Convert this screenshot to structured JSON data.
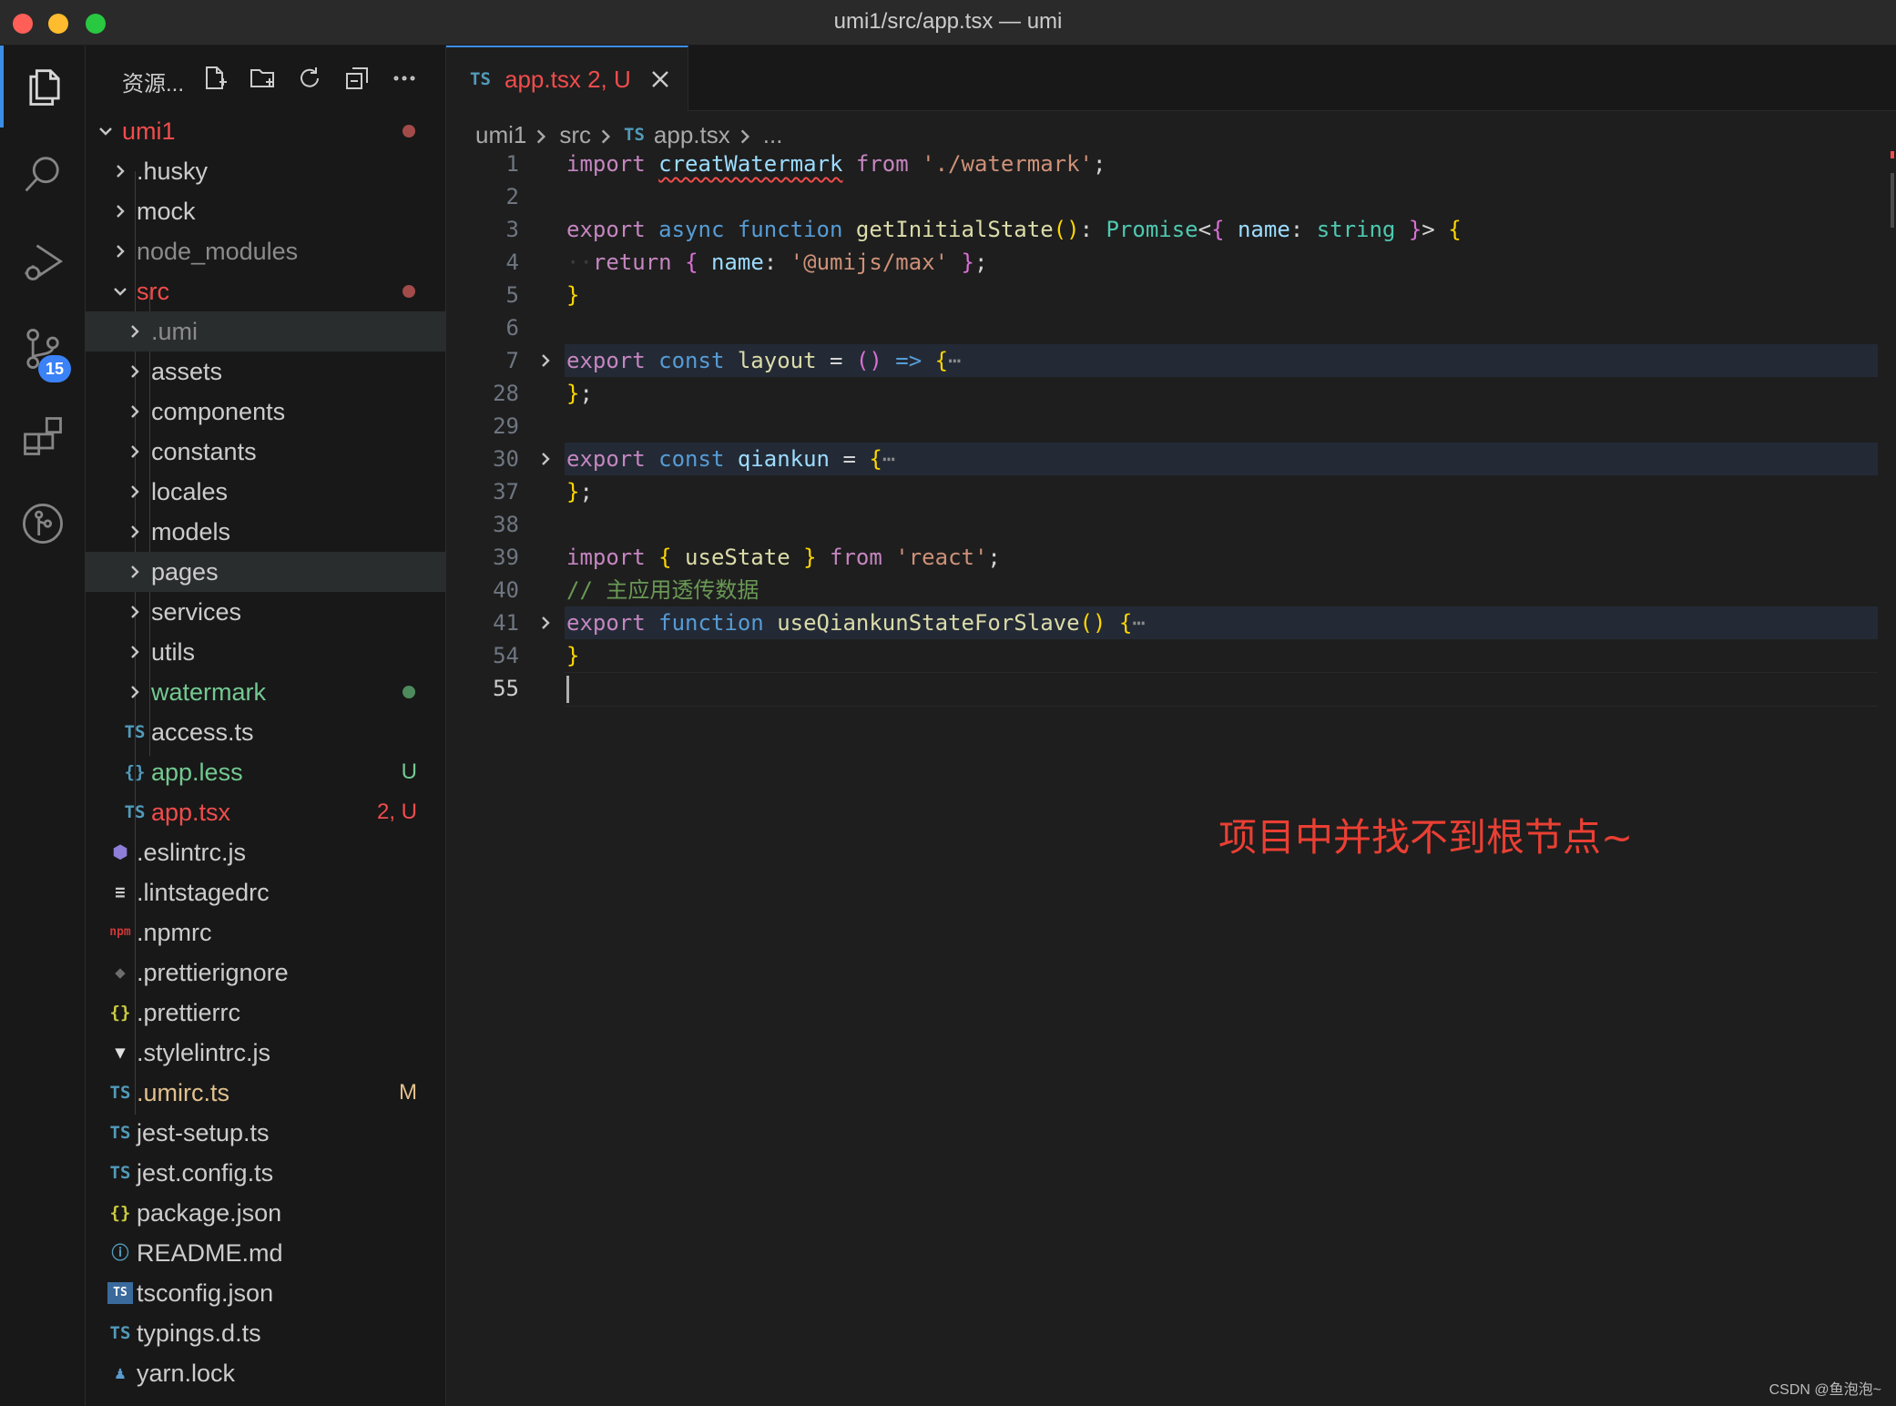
{
  "window": {
    "title": "umi1/src/app.tsx — umi"
  },
  "activity_bar": {
    "items": [
      "explorer-icon",
      "search-icon",
      "run-debug-icon",
      "source-control-icon",
      "extensions-icon",
      "git-graph-icon"
    ],
    "source_control_badge": "15"
  },
  "explorer": {
    "title": "资源...",
    "toolbar": [
      "new-file-icon",
      "new-folder-icon",
      "refresh-icon",
      "collapse-all-icon",
      "more-icon"
    ],
    "rows": [
      {
        "label": "umi1",
        "kind": "folder-open",
        "depth": 0,
        "color": "#f14c4c",
        "dot": "#a34a4a"
      },
      {
        "label": ".husky",
        "kind": "folder",
        "depth": 1
      },
      {
        "label": "mock",
        "kind": "folder",
        "depth": 1
      },
      {
        "label": "node_modules",
        "kind": "folder",
        "depth": 1,
        "color": "#8b8b8b"
      },
      {
        "label": "src",
        "kind": "folder-open",
        "depth": 1,
        "color": "#f14c4c",
        "dot": "#a34a4a"
      },
      {
        "label": ".umi",
        "kind": "folder",
        "depth": 2,
        "color": "#8b8b8b",
        "selected": true
      },
      {
        "label": "assets",
        "kind": "folder",
        "depth": 2
      },
      {
        "label": "components",
        "kind": "folder",
        "depth": 2
      },
      {
        "label": "constants",
        "kind": "folder",
        "depth": 2
      },
      {
        "label": "locales",
        "kind": "folder",
        "depth": 2
      },
      {
        "label": "models",
        "kind": "folder",
        "depth": 2
      },
      {
        "label": "pages",
        "kind": "folder",
        "depth": 2,
        "selected": true
      },
      {
        "label": "services",
        "kind": "folder",
        "depth": 2
      },
      {
        "label": "utils",
        "kind": "folder",
        "depth": 2
      },
      {
        "label": "watermark",
        "kind": "folder",
        "depth": 2,
        "color": "#73c991",
        "dot": "#4d8a5c"
      },
      {
        "label": "access.ts",
        "kind": "file",
        "icon": "TS",
        "icon_color": "#519aba",
        "depth": 2
      },
      {
        "label": "app.less",
        "kind": "file",
        "icon": "{}",
        "icon_color": "#519aba",
        "depth": 2,
        "color": "#73c991",
        "deco": "U",
        "deco_color": "#73c991"
      },
      {
        "label": "app.tsx",
        "kind": "file",
        "icon": "TS",
        "icon_color": "#519aba",
        "depth": 2,
        "color": "#f14c4c",
        "deco": "2, U",
        "deco_color": "#f14c4c"
      },
      {
        "label": ".eslintrc.js",
        "kind": "file",
        "icon": "⬢",
        "icon_color": "#8f7ed8",
        "depth": 1
      },
      {
        "label": ".lintstagedrc",
        "kind": "file",
        "icon": "≡",
        "icon_color": "#cccccc",
        "depth": 1
      },
      {
        "label": ".npmrc",
        "kind": "file",
        "icon": "npm",
        "icon_color": "#cb3837",
        "depth": 1
      },
      {
        "label": ".prettierignore",
        "kind": "file",
        "icon": "◆",
        "icon_color": "#6d6d6d",
        "depth": 1
      },
      {
        "label": ".prettierrc",
        "kind": "file",
        "icon": "{}",
        "icon_color": "#cbcb41",
        "depth": 1
      },
      {
        "label": ".stylelintrc.js",
        "kind": "file",
        "icon": "▼",
        "icon_color": "#e0e0e0",
        "depth": 1
      },
      {
        "label": ".umirc.ts",
        "kind": "file",
        "icon": "TS",
        "icon_color": "#519aba",
        "depth": 1,
        "color": "#e2c08d",
        "deco": "M",
        "deco_color": "#e2c08d"
      },
      {
        "label": "jest-setup.ts",
        "kind": "file",
        "icon": "TS",
        "icon_color": "#519aba",
        "depth": 1
      },
      {
        "label": "jest.config.ts",
        "kind": "file",
        "icon": "TS",
        "icon_color": "#519aba",
        "depth": 1
      },
      {
        "label": "package.json",
        "kind": "file",
        "icon": "{}",
        "icon_color": "#cbcb41",
        "depth": 1
      },
      {
        "label": "README.md",
        "kind": "file",
        "icon": "ⓘ",
        "icon_color": "#519aba",
        "depth": 1
      },
      {
        "label": "tsconfig.json",
        "kind": "file",
        "icon": "TS",
        "icon_color": "#ffffff",
        "icon_bg": "#3a6a9c",
        "depth": 1
      },
      {
        "label": "typings.d.ts",
        "kind": "file",
        "icon": "TS",
        "icon_color": "#519aba",
        "depth": 1
      },
      {
        "label": "yarn.lock",
        "kind": "file",
        "icon": "♟",
        "icon_color": "#5a9bcf",
        "depth": 1
      }
    ]
  },
  "tab": {
    "icon": "TS",
    "name": "app.tsx",
    "status": "2, U"
  },
  "breadcrumb": {
    "items": [
      "umi1",
      "src"
    ],
    "file": "app.tsx",
    "more": "..."
  },
  "code": {
    "current_line": "55",
    "lines": [
      {
        "n": "1",
        "tokens": [
          [
            "kw",
            "import "
          ],
          [
            "err",
            "creatWatermark"
          ],
          [
            "kw",
            " from "
          ],
          [
            "str",
            "'./watermark'"
          ],
          [
            "pl",
            ";"
          ]
        ]
      },
      {
        "n": "2",
        "tokens": []
      },
      {
        "n": "3",
        "tokens": [
          [
            "kw",
            "export "
          ],
          [
            "st",
            "async "
          ],
          [
            "st",
            "function "
          ],
          [
            "fn",
            "getInitialState"
          ],
          [
            "br1",
            "()"
          ],
          [
            "pl",
            ": "
          ],
          [
            "ty",
            "Promise"
          ],
          [
            "pl",
            "<"
          ],
          [
            "br2",
            "{"
          ],
          [
            "va",
            " name"
          ],
          [
            "pl",
            ": "
          ],
          [
            "ty",
            "string"
          ],
          [
            "br2",
            " }"
          ],
          [
            "pl",
            "> "
          ],
          [
            "br1",
            "{"
          ]
        ]
      },
      {
        "n": "4",
        "tokens": [
          [
            "ws",
            "··"
          ],
          [
            "kw",
            "return "
          ],
          [
            "br2",
            "{"
          ],
          [
            "va",
            " name"
          ],
          [
            "pl",
            ": "
          ],
          [
            "str",
            "'@umijs/max'"
          ],
          [
            "br2",
            " }"
          ],
          [
            "pl",
            ";"
          ]
        ]
      },
      {
        "n": "5",
        "tokens": [
          [
            "br1",
            "}"
          ]
        ]
      },
      {
        "n": "6",
        "tokens": []
      },
      {
        "n": "7",
        "fold": true,
        "tokens": [
          [
            "kw",
            "export "
          ],
          [
            "st",
            "const "
          ],
          [
            "fn",
            "layout"
          ],
          [
            "pl",
            " = "
          ],
          [
            "br2",
            "()"
          ],
          [
            "st",
            " => "
          ],
          [
            "br1",
            "{"
          ],
          [
            "ell",
            "⋯"
          ]
        ]
      },
      {
        "n": "28",
        "tokens": [
          [
            "br1",
            "}"
          ],
          [
            "pl",
            ";"
          ]
        ]
      },
      {
        "n": "29",
        "tokens": []
      },
      {
        "n": "30",
        "fold": true,
        "tokens": [
          [
            "kw",
            "export "
          ],
          [
            "st",
            "const "
          ],
          [
            "va",
            "qiankun"
          ],
          [
            "pl",
            " = "
          ],
          [
            "br1",
            "{"
          ],
          [
            "ell",
            "⋯"
          ]
        ]
      },
      {
        "n": "37",
        "tokens": [
          [
            "br1",
            "}"
          ],
          [
            "pl",
            ";"
          ]
        ]
      },
      {
        "n": "38",
        "tokens": []
      },
      {
        "n": "39",
        "tokens": [
          [
            "kw",
            "import "
          ],
          [
            "br1",
            "{"
          ],
          [
            "fn",
            " useState "
          ],
          [
            "br1",
            "}"
          ],
          [
            "kw",
            " from "
          ],
          [
            "str",
            "'react'"
          ],
          [
            "pl",
            ";"
          ]
        ]
      },
      {
        "n": "40",
        "tokens": [
          [
            "cm",
            "// 主应用透传数据"
          ]
        ]
      },
      {
        "n": "41",
        "fold": true,
        "tokens": [
          [
            "kw",
            "export "
          ],
          [
            "st",
            "function "
          ],
          [
            "fn",
            "useQiankunStateForSlave"
          ],
          [
            "br1",
            "() {"
          ],
          [
            "ell",
            "⋯"
          ]
        ]
      },
      {
        "n": "54",
        "tokens": [
          [
            "br1",
            "}"
          ]
        ]
      },
      {
        "n": "55",
        "tokens": []
      }
    ]
  },
  "annotation": "项目中并找不到根节点~",
  "watermark": "CSDN @鱼泡泡~",
  "colors": {
    "accent": "#3a8ee6",
    "error": "#f14c4c",
    "untracked": "#73c991",
    "modified": "#e2c08d"
  }
}
